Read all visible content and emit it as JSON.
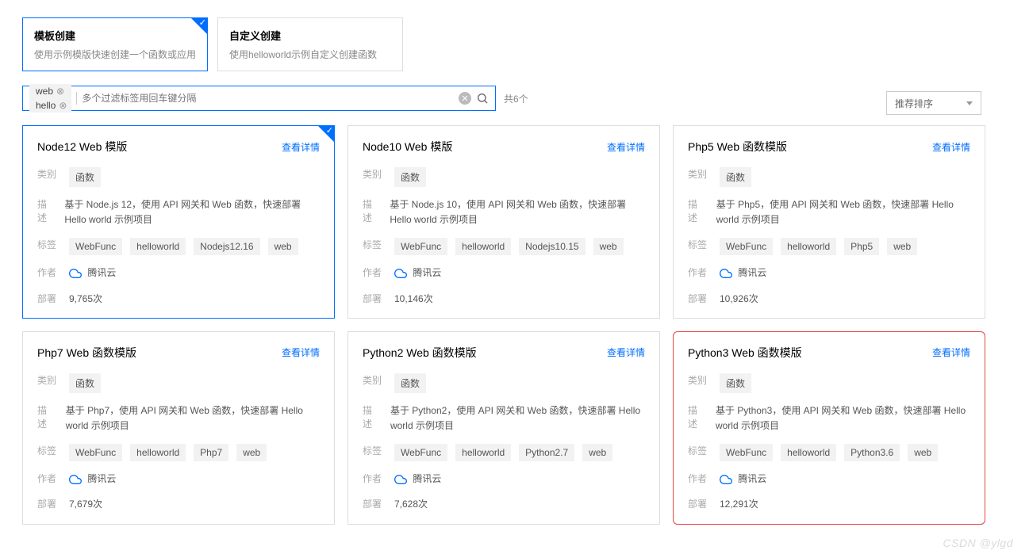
{
  "create_tabs": [
    {
      "title": "模板创建",
      "desc": "使用示例模版快速创建一个函数或应用",
      "active": true
    },
    {
      "title": "自定义创建",
      "desc": "使用helloworld示例自定义创建函数",
      "active": false
    }
  ],
  "search": {
    "tags": [
      "web",
      "hello"
    ],
    "placeholder": "多个过滤标签用回车键分隔"
  },
  "result_count_text": "共6个",
  "sort_label": "推荐排序",
  "detail_link_text": "查看详情",
  "field_labels": {
    "type": "类别",
    "desc": "描述",
    "tags": "标签",
    "author": "作者",
    "deploy": "部署"
  },
  "author_default": "腾讯云",
  "cards": [
    {
      "title": "Node12 Web 模版",
      "selected": true,
      "highlight": false,
      "type": "函数",
      "desc": "基于 Node.js 12，使用 API 网关和 Web 函数，快速部署 Hello world 示例项目",
      "tags": [
        "WebFunc",
        "helloworld",
        "Nodejs12.16",
        "web"
      ],
      "deploy": "9,765次"
    },
    {
      "title": "Node10 Web 模版",
      "selected": false,
      "highlight": false,
      "type": "函数",
      "desc": "基于 Node.js 10，使用 API 网关和 Web 函数，快速部署 Hello world 示例项目",
      "tags": [
        "WebFunc",
        "helloworld",
        "Nodejs10.15",
        "web"
      ],
      "deploy": "10,146次"
    },
    {
      "title": "Php5 Web 函数模版",
      "selected": false,
      "highlight": false,
      "type": "函数",
      "desc": "基于 Php5，使用 API 网关和 Web 函数，快速部署 Hello world 示例项目",
      "tags": [
        "WebFunc",
        "helloworld",
        "Php5",
        "web"
      ],
      "deploy": "10,926次"
    },
    {
      "title": "Php7 Web 函数模版",
      "selected": false,
      "highlight": false,
      "type": "函数",
      "desc": "基于 Php7，使用 API 网关和 Web 函数，快速部署 Hello world 示例项目",
      "tags": [
        "WebFunc",
        "helloworld",
        "Php7",
        "web"
      ],
      "deploy": "7,679次"
    },
    {
      "title": "Python2 Web 函数模版",
      "selected": false,
      "highlight": false,
      "type": "函数",
      "desc": "基于 Python2，使用 API 网关和 Web 函数，快速部署 Hello world 示例项目",
      "tags": [
        "WebFunc",
        "helloworld",
        "Python2.7",
        "web"
      ],
      "deploy": "7,628次"
    },
    {
      "title": "Python3 Web 函数模版",
      "selected": false,
      "highlight": true,
      "type": "函数",
      "desc": "基于 Python3，使用 API 网关和 Web 函数，快速部署 Hello world 示例项目",
      "tags": [
        "WebFunc",
        "helloworld",
        "Python3.6",
        "web"
      ],
      "deploy": "12,291次"
    }
  ],
  "watermark": "CSDN @ylgd"
}
